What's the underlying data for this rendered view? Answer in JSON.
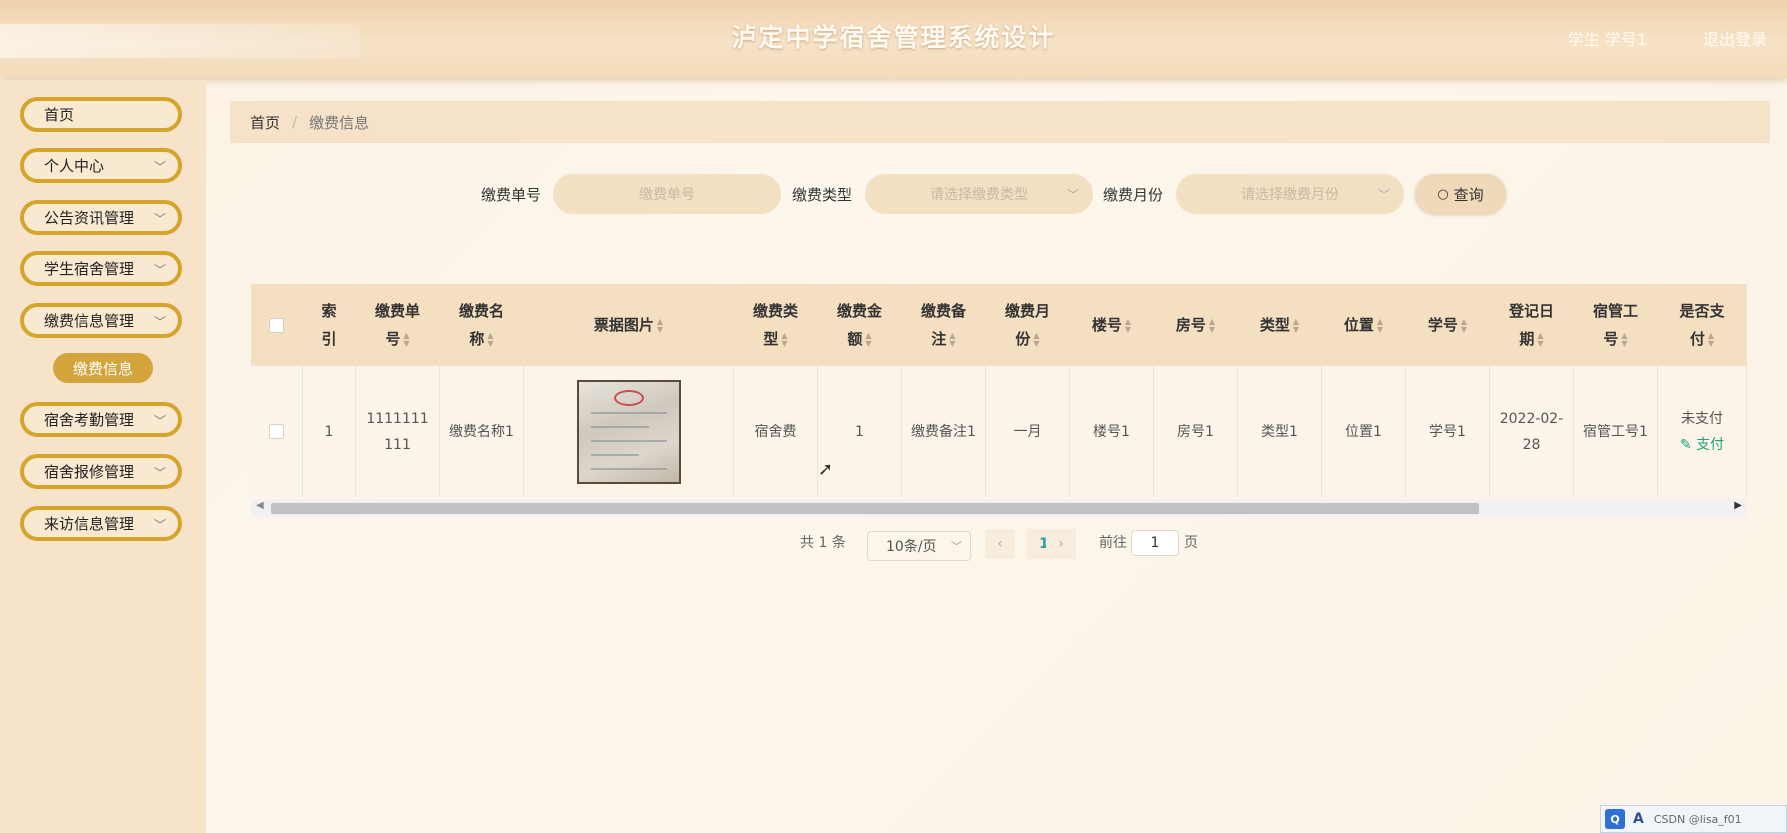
{
  "header": {
    "title": "泸定中学宿舍管理系统设计",
    "user": "学生 学号1",
    "logout": "退出登录"
  },
  "sidebar": {
    "items": [
      {
        "label": "首页"
      },
      {
        "label": "个人中心"
      },
      {
        "label": "公告资讯管理"
      },
      {
        "label": "学生宿舍管理"
      },
      {
        "label": "缴费信息管理"
      },
      {
        "label": "宿舍考勤管理"
      },
      {
        "label": "宿舍报修管理"
      },
      {
        "label": "来访信息管理"
      }
    ],
    "sub_item": "缴费信息"
  },
  "breadcrumb": {
    "home": "首页",
    "sep": "/",
    "current": "缴费信息"
  },
  "search": {
    "no_label": "缴费单号",
    "no_placeholder": "缴费单号",
    "type_label": "缴费类型",
    "type_placeholder": "请选择缴费类型",
    "month_label": "缴费月份",
    "month_placeholder": "请选择缴费月份",
    "query": "查询"
  },
  "table": {
    "headers": [
      "索\n引",
      "缴费单\n号",
      "缴费名\n称",
      "票据图片",
      "缴费类\n型",
      "缴费金\n额",
      "缴费备\n注",
      "缴费月\n份",
      "楼号",
      "房号",
      "类型",
      "位置",
      "学号",
      "登记日\n期",
      "宿管工\n号",
      "是否支\n付"
    ],
    "row": {
      "index": "1",
      "no": "1111111111",
      "name": "缴费名称1",
      "type": "宿舍费",
      "amount": "1",
      "note": "缴费备注1",
      "month": "一月",
      "building": "楼号1",
      "room": "房号1",
      "kind": "类型1",
      "location": "位置1",
      "student_no": "学号1",
      "date": "2022-02-28",
      "staff_no": "宿管工号1",
      "paid": "未支付",
      "pay_action": "支付"
    }
  },
  "pagination": {
    "total_prefix": "共",
    "total": "1",
    "total_suffix": "条",
    "page_size": "10条/页",
    "current_page": "1",
    "goto_label": "前往",
    "goto_value": "1",
    "page_label": "页"
  },
  "tray": {
    "ime": "Q",
    "lang": "A",
    "text": "CSDN @lisa_f01"
  }
}
